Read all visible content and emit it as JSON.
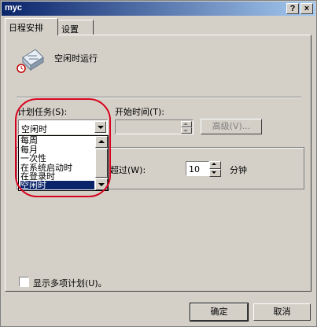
{
  "window": {
    "title": "myc",
    "help_button": "?",
    "close_button": "×"
  },
  "tabs": [
    {
      "label": "日程安排"
    },
    {
      "label": "设置"
    }
  ],
  "task": {
    "name": "空闲时运行"
  },
  "schedule": {
    "label": "计划任务(S):",
    "selected": "空闲时",
    "options": [
      "每周",
      "每月",
      "一次性",
      "在系统启动时",
      "在登录时",
      "空闲时"
    ],
    "highlighted_index": 5
  },
  "start_time": {
    "label": "开始时间(T):",
    "value": "",
    "advanced_button": "高级(V)..."
  },
  "idle": {
    "label": "超过(W):",
    "value": "10",
    "unit": "分钟"
  },
  "show_multiple": {
    "label": "显示多项计划(U)。",
    "checked": false
  },
  "footer": {
    "ok": "确定",
    "cancel": "取消"
  },
  "colors": {
    "titlebar": "#0a246a",
    "selection": "#0a246a",
    "annotation": "#d8001c",
    "face": "#d4d0c8"
  }
}
